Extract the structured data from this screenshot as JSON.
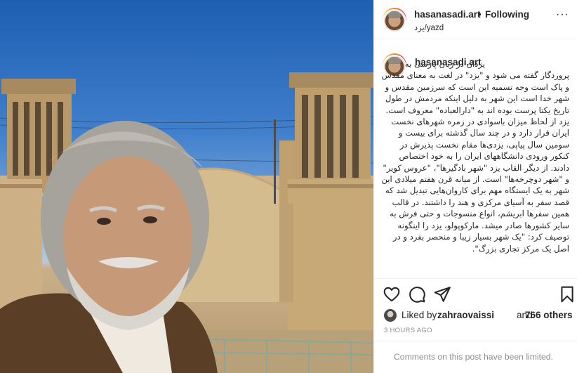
{
  "post": {
    "username": "hasanasadi.art",
    "follow_separator": "•",
    "follow_label": "Following",
    "location": "یزد/yazd",
    "more_label": "···"
  },
  "caption": {
    "username": "hasanasadi.art",
    "text": "یزدان در زبان پارسی به پروردگار گفته می شود و \"یزد\" در لغت به معنای مقدس و پاک است وجه تسمیه این است که سرزمین مقدس و شهر خدا است این شهر به دلیل اینکه مردمش در طول تاریخ یکتا پرست بوده اند به \"دارالعباده\" معروف است. یزد از لحاظ میزان باسوادی در زمره شهرهای نخست ایران قرار دارد و در چند سال گذشته برای بیست و سومین سال پیاپی، یزدی‌ها مقام نخست پذیرش در کنکور ورودی دانشگاههای ایران را به خود اختصاص دادند. از دیگر القاب یزد \"شهر بادگیرها\"، \"عروس کویر\" و \"شهر دوچرخه‌ها\" است. از میانه قرن هفتم میلادی این شهر به یک ایستگاه مهم برای کاروان‌هایی تبدیل شد که قصد سفر به آسیای مرکزی و هند را داشتند. در قالب همین سفرها ابریشم، انواع منسوجات و حتی فرش به سایر کشورها صادر میشد. مارکوپولو، یزد را اینگونه توصیف کرد: \"یک شهر بسیار زیبا و منحصر بفرد و در اصل یک مرکز تجاری بزرگ\"."
  },
  "actions": {
    "like": "heart-icon",
    "comment": "comment-icon",
    "share": "share-icon",
    "save": "bookmark-icon"
  },
  "likes": {
    "prefix": "Liked by",
    "user": "zahraovaissi",
    "and": "and",
    "others": "766 others"
  },
  "timestamp": "3 HOURS AGO",
  "comments_notice": "Comments on this post have been limited.",
  "colors": {
    "sky": "#2f6fc0",
    "brick": "#c9ae83",
    "text": "#262626",
    "muted": "#8e8e8e",
    "border": "#efefef"
  }
}
